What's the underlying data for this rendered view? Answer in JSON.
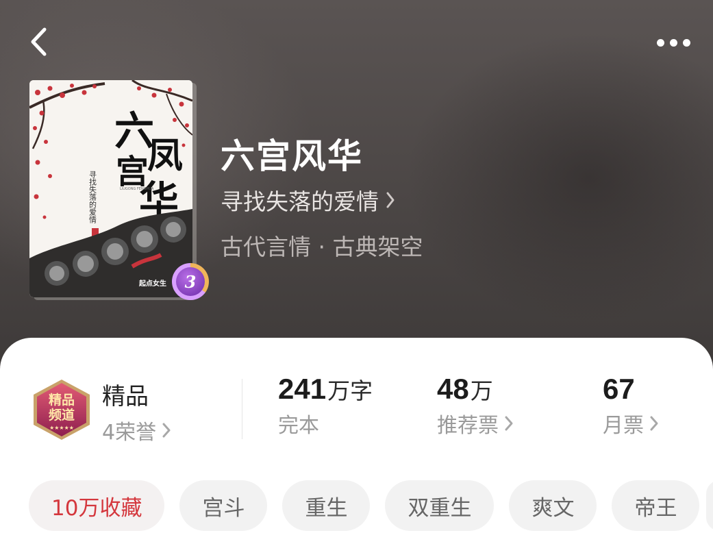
{
  "nav": {
    "back_icon": "chevron-left-icon",
    "more_icon": "more-dots-icon"
  },
  "book": {
    "title": "六宫风华",
    "author": "寻找失落的爱情",
    "genre": "古代言情 · 古典架空",
    "cover": {
      "title_chars": [
        "六",
        "凤",
        "宫",
        "华"
      ],
      "author_vertical": "寻找失落的爱情",
      "subtitle": "LIUGONG FENGHUA",
      "publisher": "起点女生",
      "badge_number": "3"
    }
  },
  "stats": {
    "quality": {
      "label": "精品",
      "honor": "4荣誉",
      "badge_lines": [
        "精品",
        "频道"
      ],
      "badge_stars": "★★★★★"
    },
    "words": {
      "value": "241",
      "unit": "万字",
      "status": "完本"
    },
    "recommend": {
      "value": "48",
      "unit": "万",
      "label": "推荐票"
    },
    "monthly": {
      "value": "67",
      "label": "月票"
    }
  },
  "tags": [
    "10万收藏",
    "宫斗",
    "重生",
    "双重生",
    "爽文",
    "帝王"
  ],
  "colors": {
    "accent_red": "#d4373d",
    "header_bg": "#4b4645",
    "tag_bg": "#f2f2f2",
    "badge_purple": "#6b2aa8"
  }
}
